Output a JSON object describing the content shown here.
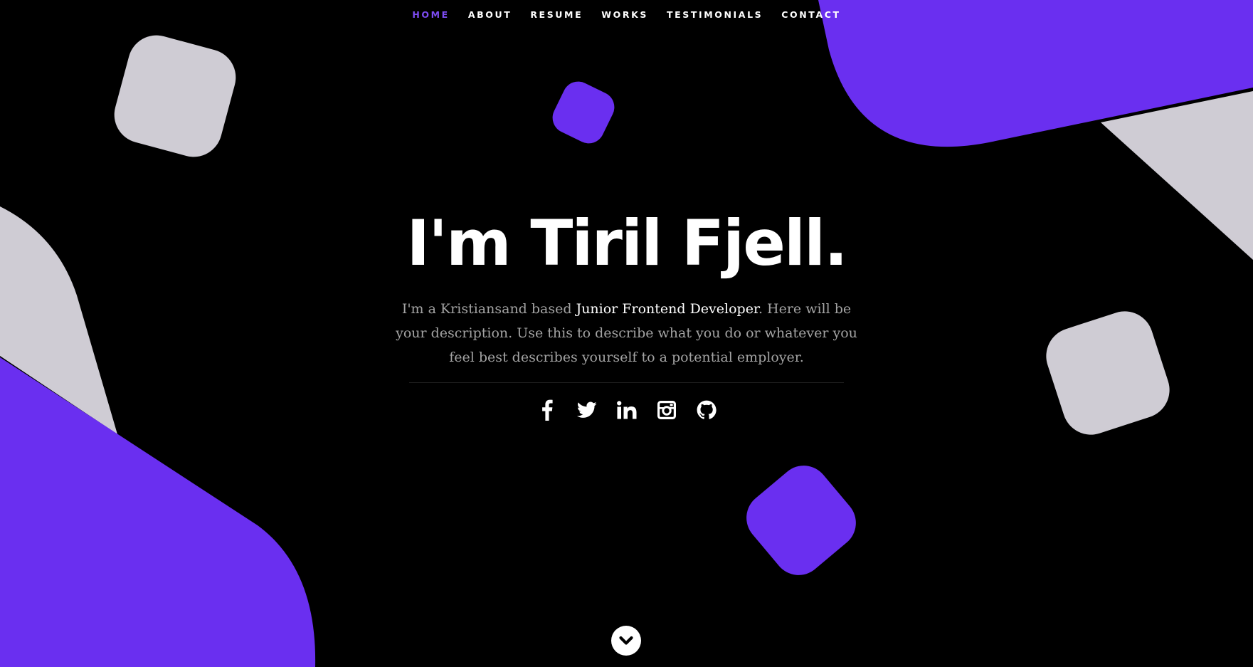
{
  "nav": {
    "items": [
      "HOME",
      "ABOUT",
      "RESUME",
      "WORKS",
      "TESTIMONIALS",
      "CONTACT"
    ]
  },
  "hero": {
    "title": "I'm Tiril Fjell.",
    "desc_prefix": "I'm a Kristiansand based ",
    "desc_highlight": "Junior Frontend Developer",
    "desc_suffix": ". Here will be your description. Use this to describe what you do or whatever you feel best describes yourself to a potential employer."
  },
  "social": [
    "facebook-icon",
    "twitter-icon",
    "linkedin-icon",
    "instagram-icon",
    "github-icon"
  ],
  "scroll": {
    "icon": "chevron-down-icon"
  },
  "colors": {
    "background": "#000000",
    "accent": "#6a2ff0",
    "shape_light": "#cfccd4",
    "text": "#ffffff",
    "text_muted": "#a3a3a3"
  }
}
